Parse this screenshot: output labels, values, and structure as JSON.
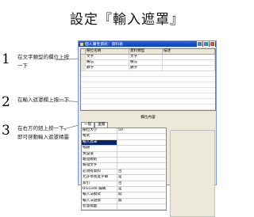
{
  "page": {
    "title": "設定『輸入遮罩』"
  },
  "steps": [
    {
      "num": "1",
      "text": "在文字類型的欄位上按一下"
    },
    {
      "num": "2",
      "text": "在輸入遮罩欄上按一下"
    },
    {
      "num": "3",
      "text": "在右方的鈕上按一下，即可啓動輸入遮罩精靈"
    }
  ],
  "window": {
    "title": "個人屬性資訊：資料表"
  },
  "field_grid": {
    "headers": [
      "欄位名稱",
      "資料類型",
      "描述"
    ],
    "rows": [
      {
        "name": "文字",
        "type": "文字"
      },
      {
        "name": "備忘",
        "type": "備忘"
      },
      {
        "name": "數字",
        "type": "數字"
      }
    ]
  },
  "properties_section": {
    "label": "欄位內容"
  },
  "tabs": [
    {
      "label": "一般"
    },
    {
      "label": "查閱"
    }
  ],
  "properties": [
    {
      "label": "欄位大小",
      "value": "50"
    },
    {
      "label": "格式",
      "value": ""
    },
    {
      "label": "輸入遮罩",
      "value": ""
    },
    {
      "label": "標題",
      "value": ""
    },
    {
      "label": "預設值",
      "value": ""
    },
    {
      "label": "驗證規則",
      "value": ""
    },
    {
      "label": "驗證文字",
      "value": ""
    },
    {
      "label": "必須有資料",
      "value": "否"
    },
    {
      "label": "允許零長度字串",
      "value": "是"
    },
    {
      "label": "索引",
      "value": "否"
    },
    {
      "label": "Unicode 編碼",
      "value": "是"
    },
    {
      "label": "輸入法模式",
      "value": "開"
    },
    {
      "label": "輸入法語態",
      "value": "無"
    },
    {
      "label": "智慧標籤",
      "value": ""
    }
  ],
  "build_button": {
    "label": "..."
  }
}
